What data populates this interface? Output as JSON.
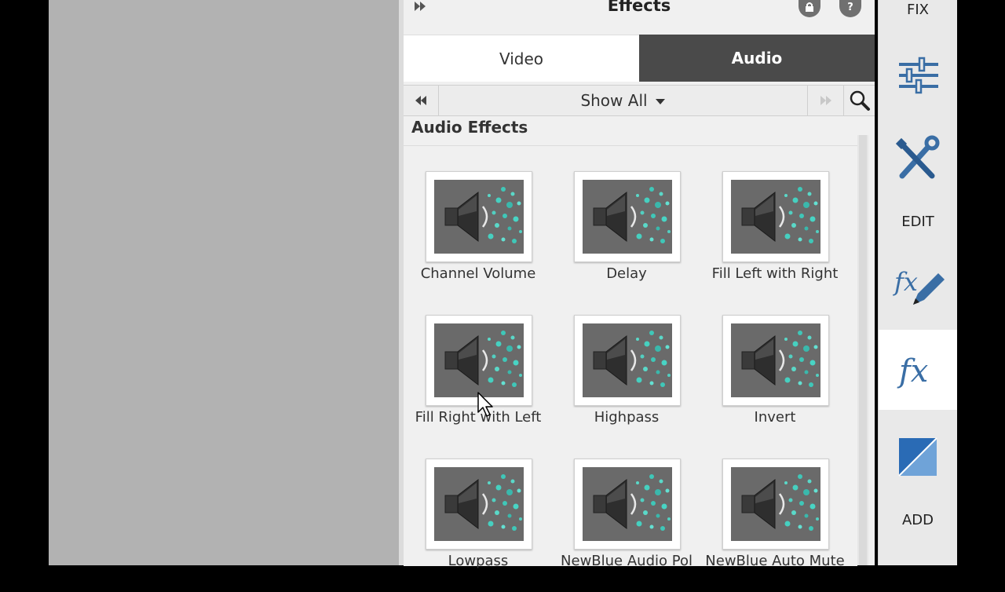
{
  "panel": {
    "title": "Effects",
    "tabs": [
      {
        "label": "Video",
        "active": false
      },
      {
        "label": "Audio",
        "active": true
      }
    ],
    "filter": {
      "label": "Show All"
    },
    "section_title": "Audio Effects"
  },
  "effects": [
    {
      "label": "Channel Volume"
    },
    {
      "label": "Delay"
    },
    {
      "label": "Fill Left with Right"
    },
    {
      "label": "Fill Right with Left"
    },
    {
      "label": "Highpass"
    },
    {
      "label": "Invert"
    },
    {
      "label": "Lowpass"
    },
    {
      "label": "NewBlue Audio Pol"
    },
    {
      "label": "NewBlue Auto Mute"
    }
  ],
  "sidebar": {
    "fix_label": "FIX",
    "edit_label": "EDIT",
    "add_label": "ADD"
  },
  "colors": {
    "active_tab": "#4a4a4a",
    "icon_blue": "#3a6ea5",
    "panel_bg": "#f0f0f0"
  }
}
